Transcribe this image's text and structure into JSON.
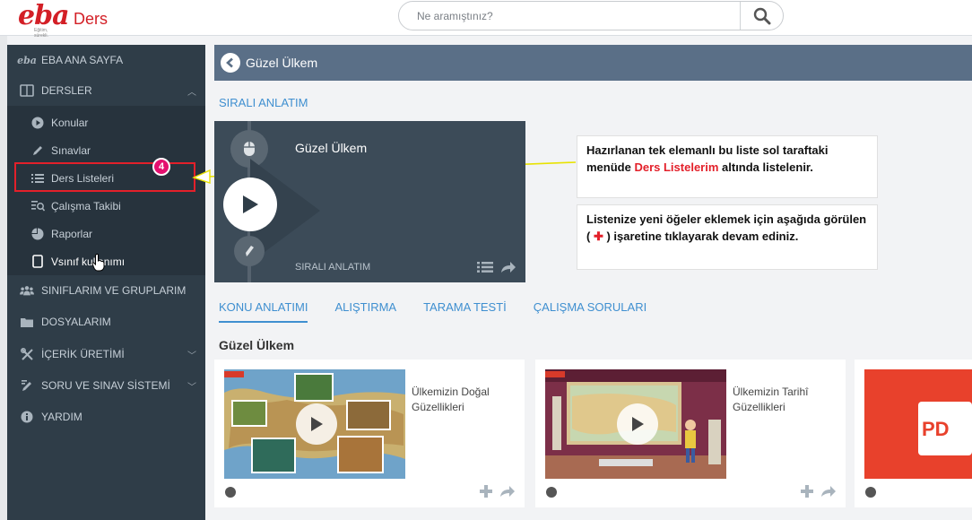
{
  "header": {
    "logo_text": "eba",
    "logo_suffix": "Ders",
    "logo_tagline": "Eğitim, sürekli.",
    "search_placeholder": "Ne aramıştınız?"
  },
  "sidebar": {
    "items": [
      {
        "label": "EBA ANA SAYFA",
        "icon": "eba-logo-icon"
      },
      {
        "label": "DERSLER",
        "icon": "book-icon",
        "expanded": true
      },
      {
        "label": "SINIFLARIM VE GRUPLARIM",
        "icon": "users-icon"
      },
      {
        "label": "DOSYALARIM",
        "icon": "folder-icon"
      },
      {
        "label": "İÇERİK ÜRETİMİ",
        "icon": "tools-icon"
      },
      {
        "label": "SORU VE SINAV SİSTEMİ",
        "icon": "exam-icon"
      },
      {
        "label": "YARDIM",
        "icon": "info-icon"
      }
    ],
    "sub_items": [
      {
        "label": "Konular",
        "icon": "play-circle-icon"
      },
      {
        "label": "Sınavlar",
        "icon": "pencil-icon"
      },
      {
        "label": "Ders Listeleri",
        "icon": "list-icon"
      },
      {
        "label": "Çalışma Takibi",
        "icon": "tracking-icon"
      },
      {
        "label": "Raporlar",
        "icon": "pie-chart-icon"
      },
      {
        "label": "Vsınıf kullanımı",
        "icon": "tablet-icon"
      }
    ],
    "badge": "4"
  },
  "main": {
    "title": "Güzel Ülkem",
    "section_label": "SIRALI ANLATIM",
    "sequence_card": {
      "title": "Güzel Ülkem",
      "footer": "SIRALI ANLATIM"
    },
    "note1": {
      "text_before": "Hazırlanan  tek elemanlı bu liste sol taraftaki menüde ",
      "highlight": "Ders Listelerim",
      "text_after": " altında listelenir."
    },
    "note2": {
      "text_before": "Listenize yeni öğeler eklemek  için aşağıda görülen ( ",
      "symbol": "✚",
      "text_after": " ) işaretine tıklayarak devam ediniz."
    },
    "tabs": [
      "KONU ANLATIMI",
      "ALIŞTIRMA",
      "TARAMA TESTİ",
      "ÇALIŞMA SORULARI"
    ],
    "active_tab": 0,
    "group_title": "Güzel Ülkem",
    "cards": [
      {
        "title": "Ülkemizin Doğal Güzellikleri",
        "thumb": "map-thumbnail"
      },
      {
        "title": "Ülkemizin Tarihî Güzellikleri",
        "thumb": "history-thumbnail"
      },
      {
        "title": "",
        "thumb": "pdf-thumbnail"
      }
    ]
  },
  "colors": {
    "brand_red": "#d31f26",
    "sidebar_bg": "#2f3d48",
    "title_bar": "#5a6f87",
    "link_blue": "#3f8fd0",
    "highlight_red": "#e3202a",
    "badge_pink": "#e4106f",
    "annotation_yellow": "#e8e200"
  }
}
